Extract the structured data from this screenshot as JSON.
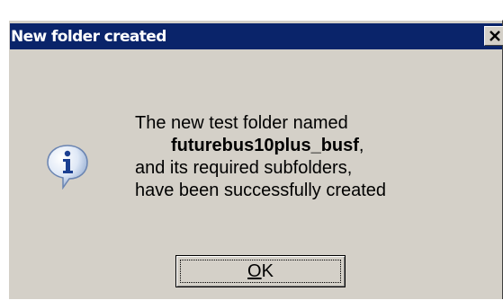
{
  "dialog": {
    "title": "New folder created",
    "close_glyph": "×",
    "icon": "info-icon",
    "message": {
      "line1": "The new test folder named",
      "folder_name": "futurebus10plus_busf",
      "folder_suffix": ",",
      "line3": "and its required subfolders,",
      "line4": "have been successfully created"
    },
    "ok_button": {
      "accelerator": "O",
      "label_rest": "K"
    }
  },
  "colors": {
    "titlebar": "#0a246a",
    "dialog_face": "#d4d0c8",
    "title_text": "#ffffff"
  }
}
